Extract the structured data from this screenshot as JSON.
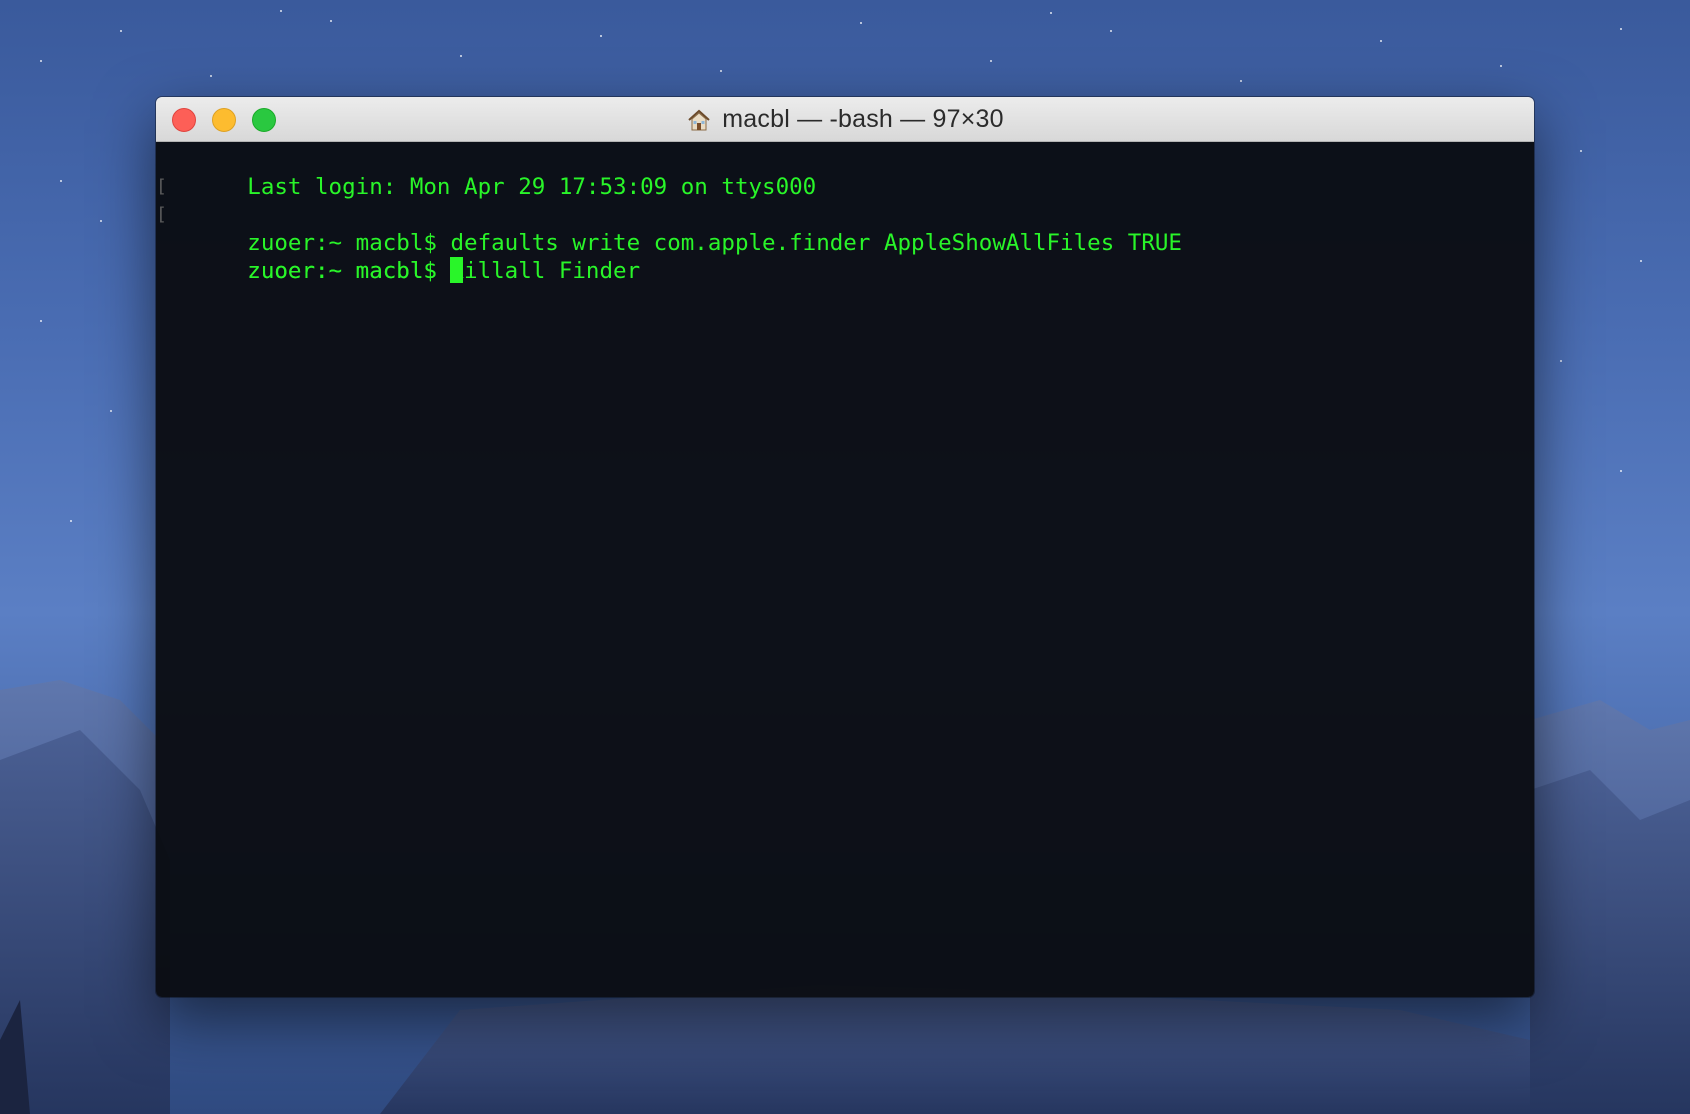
{
  "window": {
    "title": "macbl — -bash — 97×30"
  },
  "terminal": {
    "lines": [
      {
        "text": "Last login: Mon Apr 29 17:53:09 on ttys000",
        "marked": false
      },
      {
        "text": "zuoer:~ macbl$ defaults write com.apple.finder AppleShowAllFiles TRUE",
        "marked": true
      },
      {
        "text": "zuoer:~ macbl$ killall Finder",
        "marked": true
      },
      {
        "text": "zuoer:~ macbl$ ",
        "marked": false
      }
    ]
  },
  "colors": {
    "text": "#29f529",
    "background": "#0a0c12",
    "close": "#fd5f57",
    "minimize": "#fdbc2f",
    "zoom": "#2ac840"
  },
  "icons": {
    "title": "home-icon",
    "close": "close-button",
    "minimize": "minimize-button",
    "zoom": "zoom-button"
  }
}
